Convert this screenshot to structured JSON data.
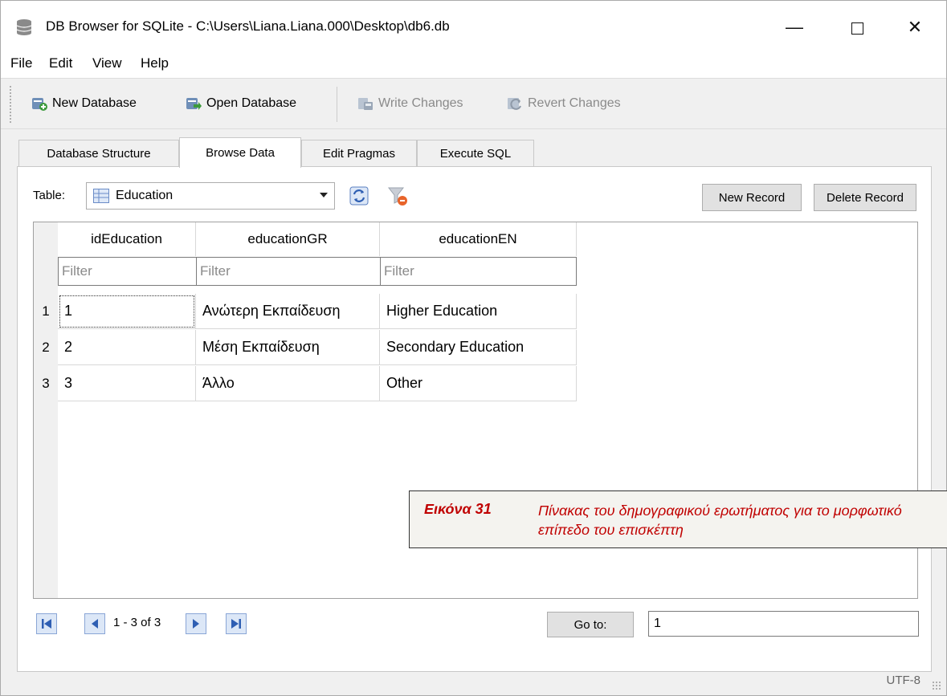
{
  "window": {
    "title": "DB Browser for SQLite - C:\\Users\\Liana.Liana.000\\Desktop\\db6.db",
    "icon": "database-icon"
  },
  "menu": [
    {
      "label": "File"
    },
    {
      "label": "Edit"
    },
    {
      "label": "View"
    },
    {
      "label": "Help"
    }
  ],
  "toolbar": {
    "new_database": "New Database",
    "open_database": "Open Database",
    "write_changes": "Write Changes",
    "revert_changes": "Revert Changes"
  },
  "tabs": [
    {
      "label": "Database Structure"
    },
    {
      "label": "Browse Data"
    },
    {
      "label": "Edit Pragmas"
    },
    {
      "label": "Execute SQL"
    }
  ],
  "active_tab": "Browse Data",
  "browse": {
    "table_label": "Table:",
    "selected_table": "Education",
    "new_record": "New Record",
    "delete_record": "Delete Record"
  },
  "grid": {
    "columns": [
      "idEducation",
      "educationGR",
      "educationEN"
    ],
    "filter_placeholder": "Filter",
    "rows": [
      {
        "num": "1",
        "cells": [
          "1",
          "Ανώτερη Εκπαίδευση",
          "Higher Education"
        ]
      },
      {
        "num": "2",
        "cells": [
          "2",
          "Μέση Εκπαίδευση",
          "Secondary Education"
        ]
      },
      {
        "num": "3",
        "cells": [
          "3",
          "Άλλο",
          "Other"
        ]
      }
    ]
  },
  "caption": {
    "number": "Εικόνα 31",
    "text": "Πίνακας του δημογραφικού ερωτήματος για το μορφωτικό επίπεδο του επισκέπτη"
  },
  "pagination": {
    "range_text": "1 - 3 of 3",
    "goto_label": "Go to:",
    "goto_value": "1"
  },
  "status": {
    "encoding": "UTF-8"
  }
}
